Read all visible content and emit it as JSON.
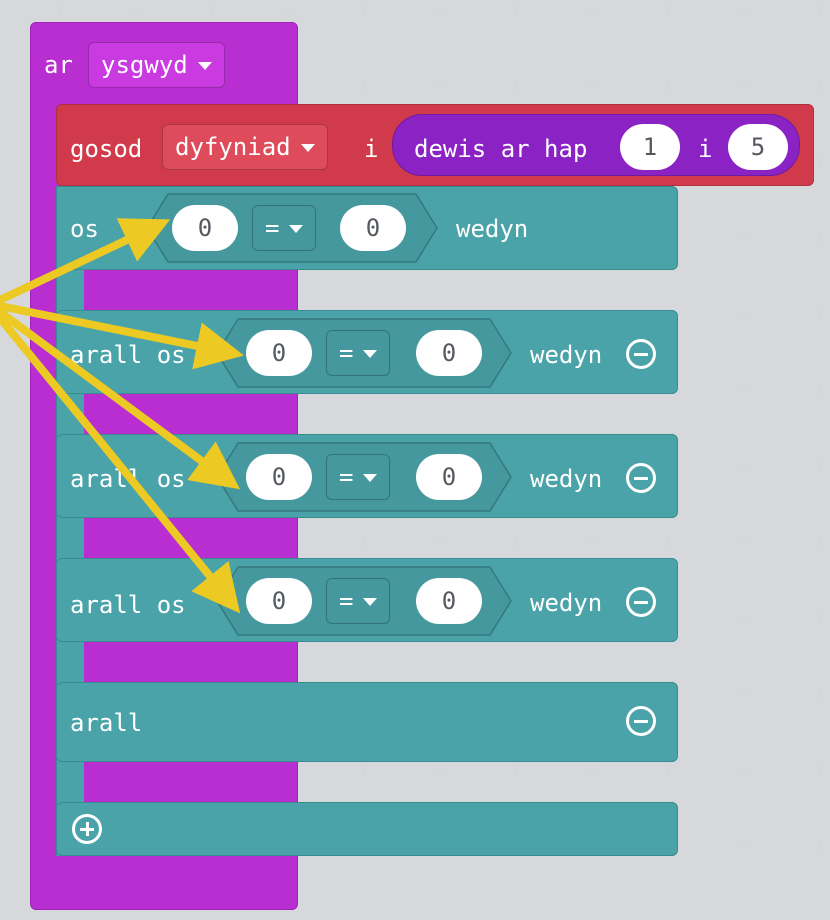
{
  "event_block": {
    "keyword": "ar",
    "dropdown_value": "ysgwyd"
  },
  "set_block": {
    "keyword": "gosod",
    "variable": "dyfyniad",
    "to_label": "i",
    "random": {
      "label": "dewis ar hap",
      "from": "1",
      "to_label": "i",
      "to": "5"
    }
  },
  "if_block": {
    "if_label": "os",
    "then_label": "wedyn",
    "else_if_label": "arall os",
    "else_label": "arall",
    "conditions": [
      {
        "left": "0",
        "operator": "=",
        "right": "0"
      },
      {
        "left": "0",
        "operator": "=",
        "right": "0"
      },
      {
        "left": "0",
        "operator": "=",
        "right": "0"
      },
      {
        "left": "0",
        "operator": "=",
        "right": "0"
      }
    ]
  },
  "colors": {
    "event": "#b82ed1",
    "set_variable": "#d13a4a",
    "random": "#8b22c4",
    "logic": "#4aa3a8",
    "arrow": "#ecc923",
    "workspace": "#eceef1"
  },
  "icons": {
    "remove": "minus-circle-icon",
    "add": "plus-circle-icon",
    "dropdown": "caret-down-icon"
  }
}
